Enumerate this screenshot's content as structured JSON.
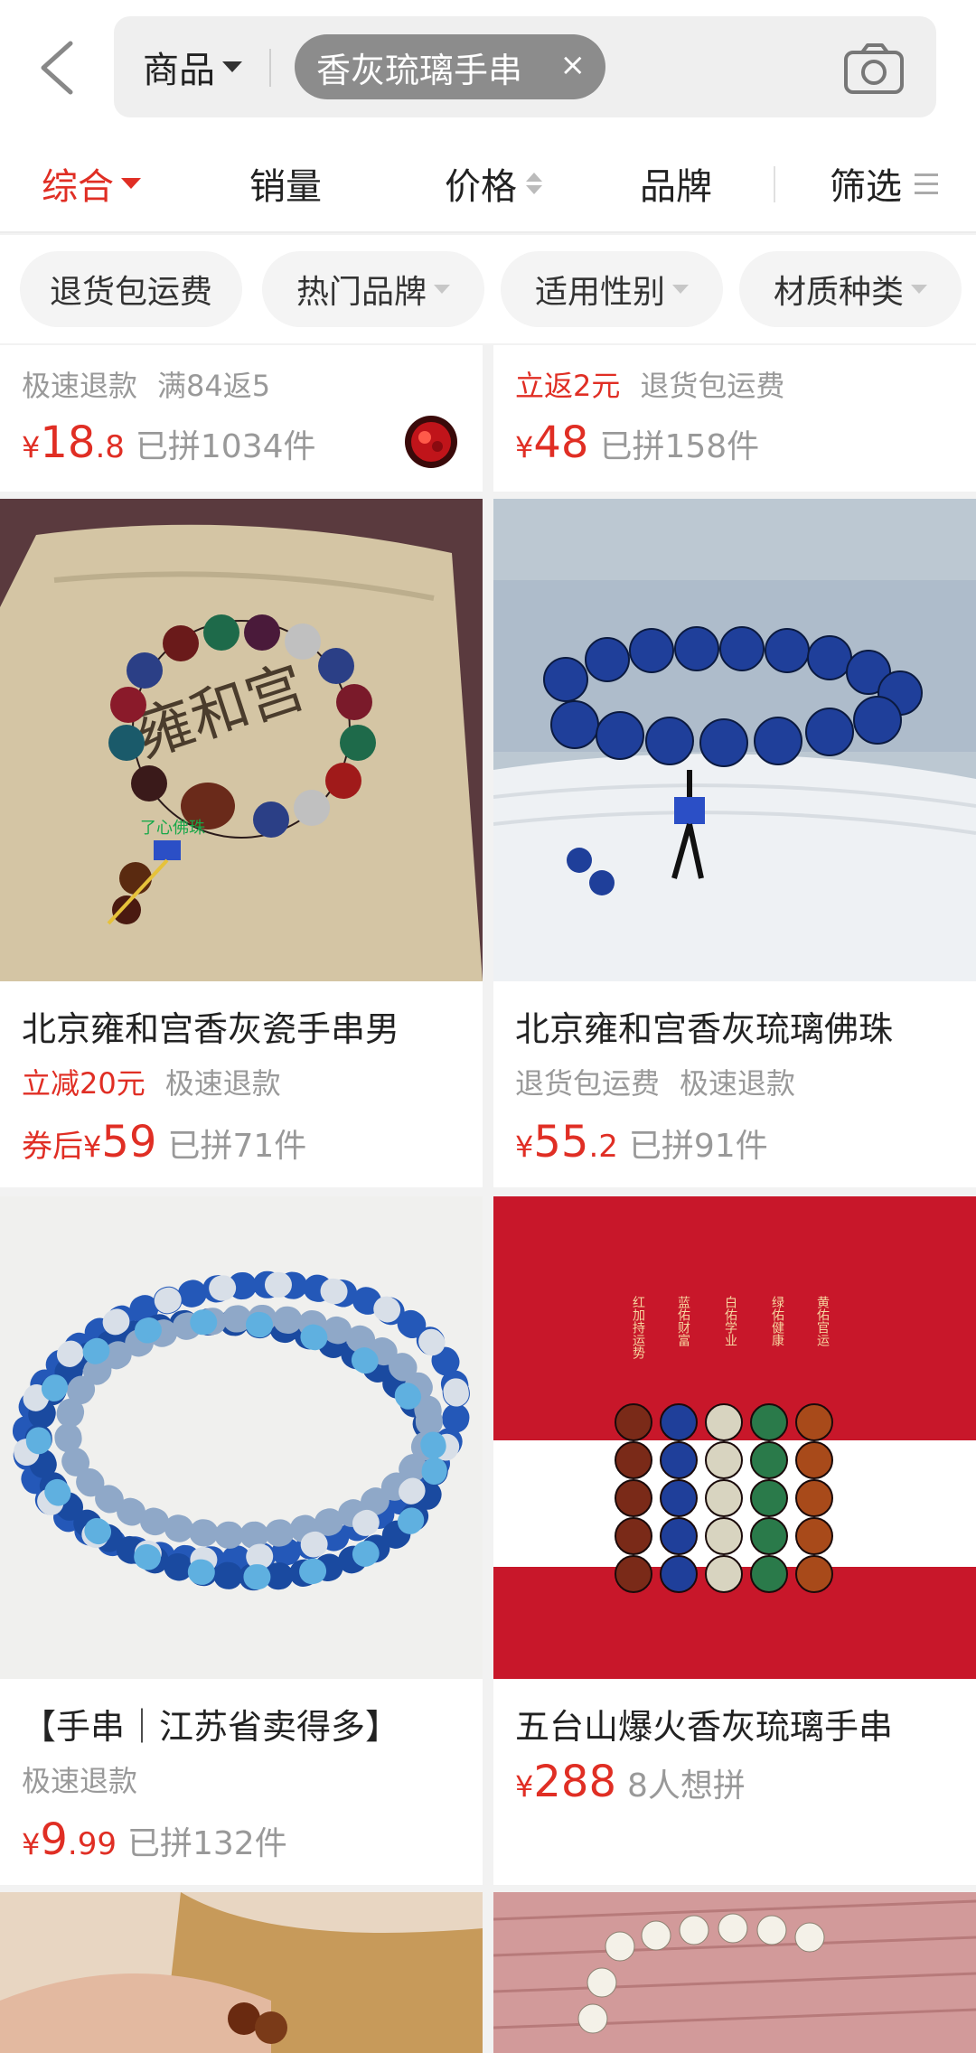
{
  "search": {
    "scope_label": "商品",
    "query_chip": "香灰琉璃手串",
    "clear_icon": "close-icon",
    "camera_icon": "camera-icon"
  },
  "sort_tabs": [
    "综合",
    "销量",
    "价格",
    "品牌",
    "筛选"
  ],
  "filter_chips": [
    "退货包运费",
    "热门品牌",
    "适用性别",
    "材质种类"
  ],
  "partial_cards": [
    {
      "tags": [
        "极速退款",
        "满84返5"
      ],
      "tag_red": [
        false,
        false
      ],
      "price_int": "18",
      "price_dec": ".8",
      "sold": "已拼1034件"
    },
    {
      "tags": [
        "立返2元",
        "退货包运费"
      ],
      "tag_red": [
        true,
        false
      ],
      "price_int": "48",
      "price_dec": "",
      "sold": "已拼158件"
    }
  ],
  "products": [
    {
      "title": "北京雍和宫香灰瓷手串男",
      "tags": [
        "立减20元",
        "极速退款"
      ],
      "tag_red": [
        true,
        false
      ],
      "price_prefix": "券后",
      "currency": "¥",
      "price_int": "59",
      "price_dec": "",
      "sold": "已拼71件",
      "image_text": "雍和宫",
      "image_watermark": "了心佛珠"
    },
    {
      "title": "北京雍和宫香灰琉璃佛珠",
      "tags": [
        "退货包运费",
        "极速退款"
      ],
      "tag_red": [
        false,
        false
      ],
      "price_prefix": "",
      "currency": "¥",
      "price_int": "55",
      "price_dec": ".2",
      "sold": "已拼91件"
    },
    {
      "title": "【手串｜江苏省卖得多】",
      "tags": [
        "极速退款"
      ],
      "tag_red": [
        false
      ],
      "price_prefix": "",
      "currency": "¥",
      "price_int": "9",
      "price_dec": ".99",
      "sold": "已拼132件"
    },
    {
      "title": "五台山爆火香灰琉璃手串",
      "tags": [],
      "tag_red": [],
      "price_prefix": "",
      "currency": "¥",
      "price_int": "288",
      "price_dec": "",
      "sold": "8人想拼",
      "image_columns": [
        "红加持运势",
        "蓝佑财富",
        "白佑学业",
        "绿佑健康",
        "黄佑官运"
      ]
    }
  ],
  "currency": "¥",
  "colors": {
    "accent": "#e02e24",
    "muted": "#999999"
  }
}
